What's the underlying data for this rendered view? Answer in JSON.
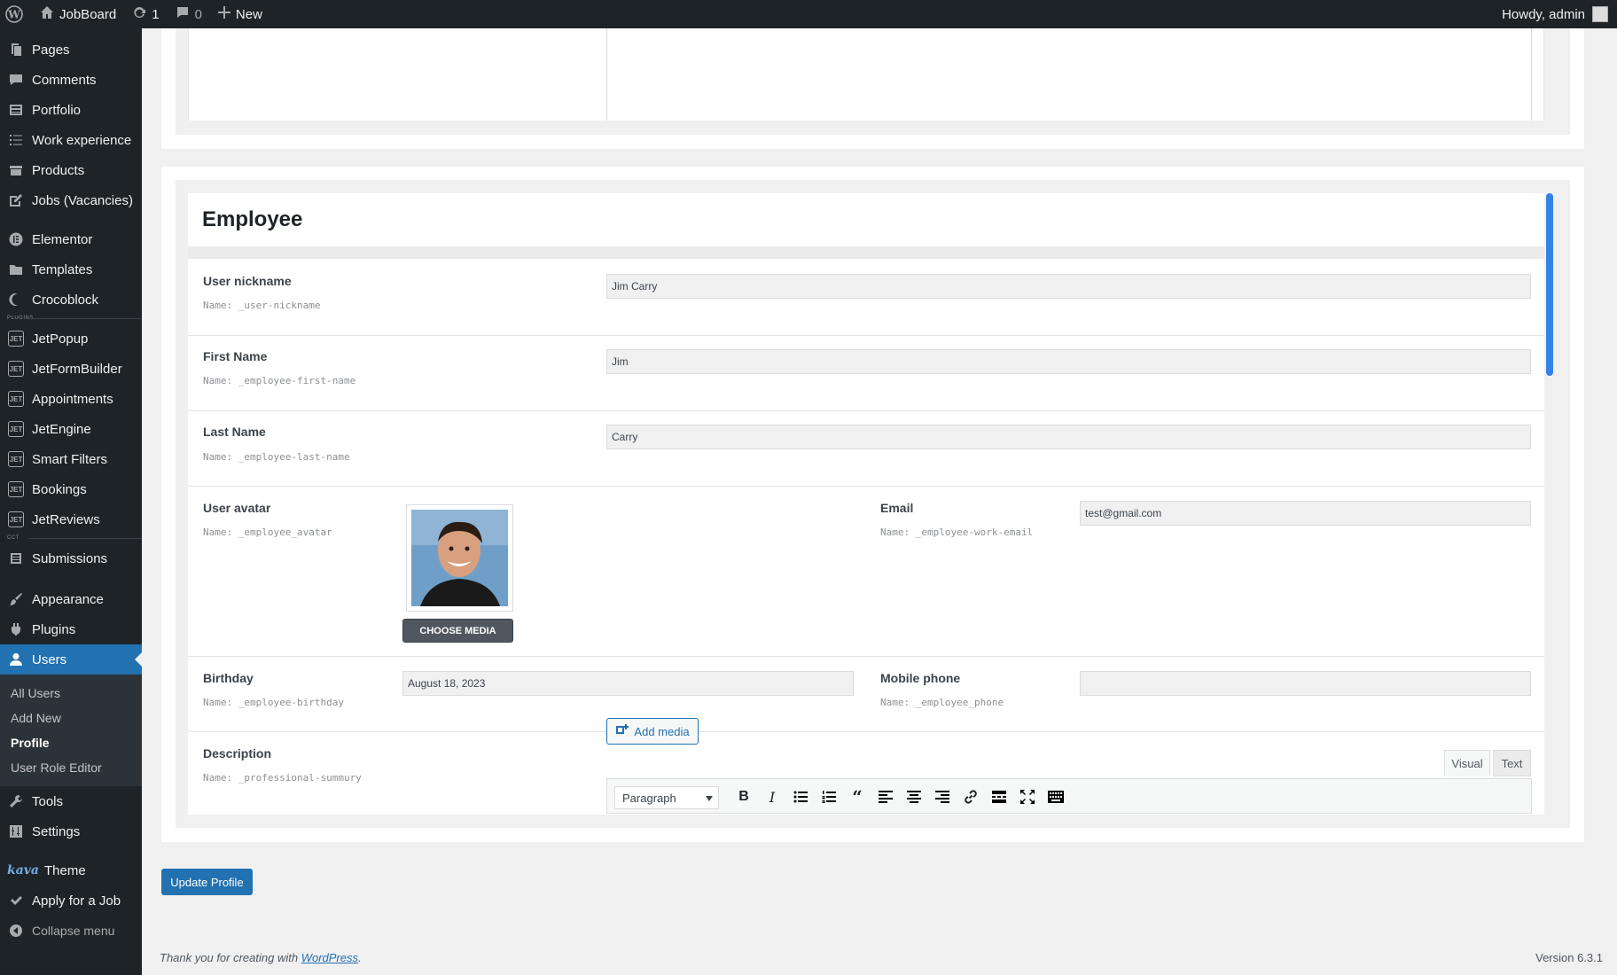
{
  "adminbar": {
    "site_name": "JobBoard",
    "updates_count": "1",
    "comments_count": "0",
    "new_label": "New",
    "howdy": "Howdy, admin"
  },
  "sidebar": {
    "items": [
      {
        "label": "Pages",
        "icon": "pages-icon"
      },
      {
        "label": "Comments",
        "icon": "comments-icon"
      },
      {
        "label": "Portfolio",
        "icon": "portfolio-icon"
      },
      {
        "label": "Work experience",
        "icon": "list-icon"
      },
      {
        "label": "Products",
        "icon": "products-icon"
      },
      {
        "label": "Jobs (Vacancies)",
        "icon": "edit-icon"
      },
      {
        "label": "Elementor",
        "icon": "elementor-icon"
      },
      {
        "label": "Templates",
        "icon": "folder-icon"
      },
      {
        "label": "Crocoblock",
        "icon": "crocoblock-icon"
      },
      {
        "label": "JetPopup",
        "icon": "jet-icon"
      },
      {
        "label": "JetFormBuilder",
        "icon": "jet-icon"
      },
      {
        "label": "Appointments",
        "icon": "jet-icon"
      },
      {
        "label": "JetEngine",
        "icon": "jet-icon"
      },
      {
        "label": "Smart Filters",
        "icon": "jet-icon"
      },
      {
        "label": "Bookings",
        "icon": "jet-icon"
      },
      {
        "label": "JetReviews",
        "icon": "jet-icon"
      },
      {
        "label": "Submissions",
        "icon": "submissions-icon"
      },
      {
        "label": "Appearance",
        "icon": "appearance-icon"
      },
      {
        "label": "Plugins",
        "icon": "plugins-icon"
      },
      {
        "label": "Users",
        "icon": "users-icon"
      },
      {
        "label": "Tools",
        "icon": "tools-icon"
      },
      {
        "label": "Settings",
        "icon": "settings-icon"
      },
      {
        "label": "Theme",
        "icon": "kava-logo"
      },
      {
        "label": "Apply for a Job",
        "icon": "check-icon"
      },
      {
        "label": "Collapse menu",
        "icon": "collapse-icon"
      }
    ],
    "sep_plugins": "PLUGINS",
    "sep_cct": "CCT",
    "kava": "kava",
    "users_submenu": [
      "All Users",
      "Add New",
      "Profile",
      "User Role Editor"
    ]
  },
  "section": {
    "title": "Employee"
  },
  "fields": {
    "nickname": {
      "label": "User nickname",
      "name": "Name: _user-nickname",
      "value": "Jim Carry"
    },
    "first_name": {
      "label": "First Name",
      "name": "Name: _employee-first-name",
      "value": "Jim"
    },
    "last_name": {
      "label": "Last Name",
      "name": "Name: _employee-last-name",
      "value": "Carry"
    },
    "avatar": {
      "label": "User avatar",
      "name": "Name: _employee_avatar",
      "button": "CHOOSE MEDIA"
    },
    "email": {
      "label": "Email",
      "name": "Name: _employee-work-email",
      "value": "test@gmail.com"
    },
    "birthday": {
      "label": "Birthday",
      "name": "Name: _employee-birthday",
      "value": "August 18, 2023"
    },
    "phone": {
      "label": "Mobile phone",
      "name": "Name: _employee_phone",
      "value": ""
    },
    "description": {
      "label": "Description",
      "name": "Name: _professional-summury"
    }
  },
  "editor": {
    "add_media": "Add media",
    "tab_visual": "Visual",
    "tab_text": "Text",
    "format": "Paragraph"
  },
  "update_button": "Update Profile",
  "footer": {
    "thanks_prefix": "Thank you for creating with ",
    "wordpress_link": "WordPress",
    "thanks_suffix": ".",
    "version": "Version 6.3.1"
  },
  "colors": {
    "admin_bg": "#1d2327",
    "accent": "#2271b1",
    "scrollbar": "#3582e6"
  }
}
